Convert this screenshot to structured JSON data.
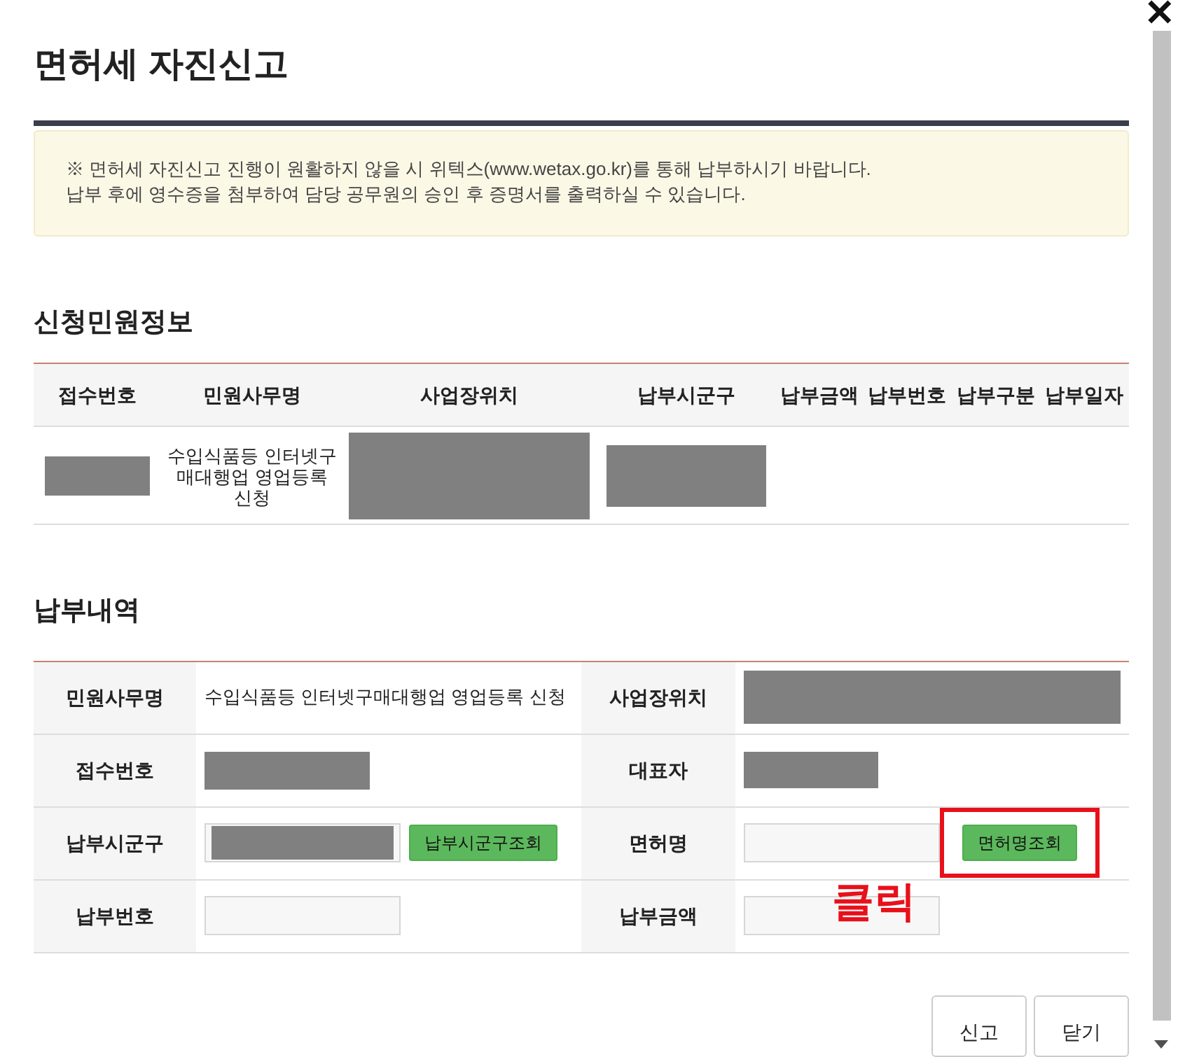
{
  "title": "면허세 자진신고",
  "close": "✕",
  "notice": [
    "※ 면허세 자진신고 진행이 원활하지 않을 시 위텍스(www.wetax.go.kr)를 통해 납부하시기 바랍니다.",
    "납부 후에 영수증을 첨부하여 담당 공무원의 승인 후 증명서를 출력하실 수 있습니다."
  ],
  "applicant": {
    "heading": "신청민원정보",
    "columns": [
      "접수번호",
      "민원사무명",
      "사업장위치",
      "납부시군구",
      "납부금액",
      "납부번호",
      "납부구분",
      "납부일자"
    ],
    "rows": [
      {
        "cells": [
          {
            "kind": "redacted"
          },
          {
            "kind": "text",
            "text": "수입식품등 인터넷구매대행업 영업등록 신청"
          },
          {
            "kind": "redacted"
          },
          {
            "kind": "redacted"
          },
          {
            "kind": "empty"
          },
          {
            "kind": "empty"
          },
          {
            "kind": "empty"
          },
          {
            "kind": "empty"
          }
        ]
      }
    ]
  },
  "payment": {
    "heading": "납부내역",
    "rows": [
      {
        "fields": [
          {
            "label": "민원사무명",
            "kind": "text",
            "text": "수입식품등 인터넷구매대행업 영업등록 신청"
          },
          {
            "label": "사업장위치",
            "kind": "redacted"
          }
        ]
      },
      {
        "fields": [
          {
            "label": "접수번호",
            "kind": "redacted"
          },
          {
            "label": "대표자",
            "kind": "redacted"
          }
        ]
      },
      {
        "fields": [
          {
            "label": "납부시군구",
            "kind": "input",
            "redacted": true,
            "button": "납부시군구조회",
            "highlighted": false
          },
          {
            "label": "면허명",
            "kind": "input",
            "redacted": false,
            "button": "면허명조회",
            "highlighted": true
          }
        ]
      },
      {
        "fields": [
          {
            "label": "납부번호",
            "kind": "input",
            "redacted": false
          },
          {
            "label": "납부금액",
            "kind": "input",
            "redacted": false
          }
        ]
      }
    ]
  },
  "annotation": "클릭",
  "buttons": [
    "신고",
    "닫기"
  ]
}
